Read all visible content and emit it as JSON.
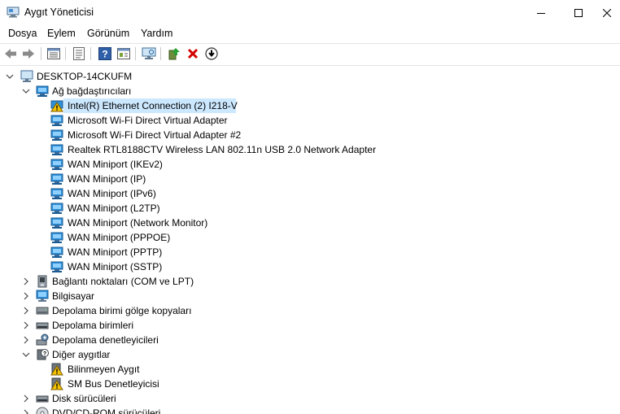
{
  "window": {
    "title": "Aygıt Yöneticisi"
  },
  "menu": [
    "Dosya",
    "Eylem",
    "Görünüm",
    "Yardım"
  ],
  "toolbar": [
    "back-icon",
    "forward-icon",
    "properties-list-icon",
    "tree-view-icon",
    "help-icon",
    "show-hidden-icon",
    "monitor-scan-icon",
    "update-driver-icon",
    "uninstall-icon",
    "disable-icon"
  ],
  "tree": {
    "root": "DESKTOP-14CKUFM",
    "network": {
      "label": "Ağ bağdaştırıcıları",
      "items": [
        "Intel(R) Ethernet Connection (2) I218-V",
        "Microsoft Wi-Fi Direct Virtual Adapter",
        "Microsoft Wi-Fi Direct Virtual Adapter #2",
        "Realtek RTL8188CTV Wireless LAN 802.11n USB 2.0 Network Adapter",
        "WAN Miniport (IKEv2)",
        "WAN Miniport (IP)",
        "WAN Miniport (IPv6)",
        "WAN Miniport (L2TP)",
        "WAN Miniport (Network Monitor)",
        "WAN Miniport (PPPOE)",
        "WAN Miniport (PPTP)",
        "WAN Miniport (SSTP)"
      ]
    },
    "ports": "Bağlantı noktaları (COM ve LPT)",
    "computer": "Bilgisayar",
    "shadow": "Depolama birimi gölge kopyaları",
    "volumes": "Depolama birimleri",
    "controllers": "Depolama denetleyicileri",
    "other": {
      "label": "Diğer aygıtlar",
      "items": [
        "Bilinmeyen Aygıt",
        "SM Bus Denetleyicisi"
      ]
    },
    "disks": "Disk sürücüleri",
    "dvd": "DVD/CD-ROM sürücüleri"
  },
  "colors": {
    "selection": "#cce8ff",
    "warning": "#f5c400",
    "error_x": "#d40000",
    "network_icon": "#2f8fd8"
  }
}
